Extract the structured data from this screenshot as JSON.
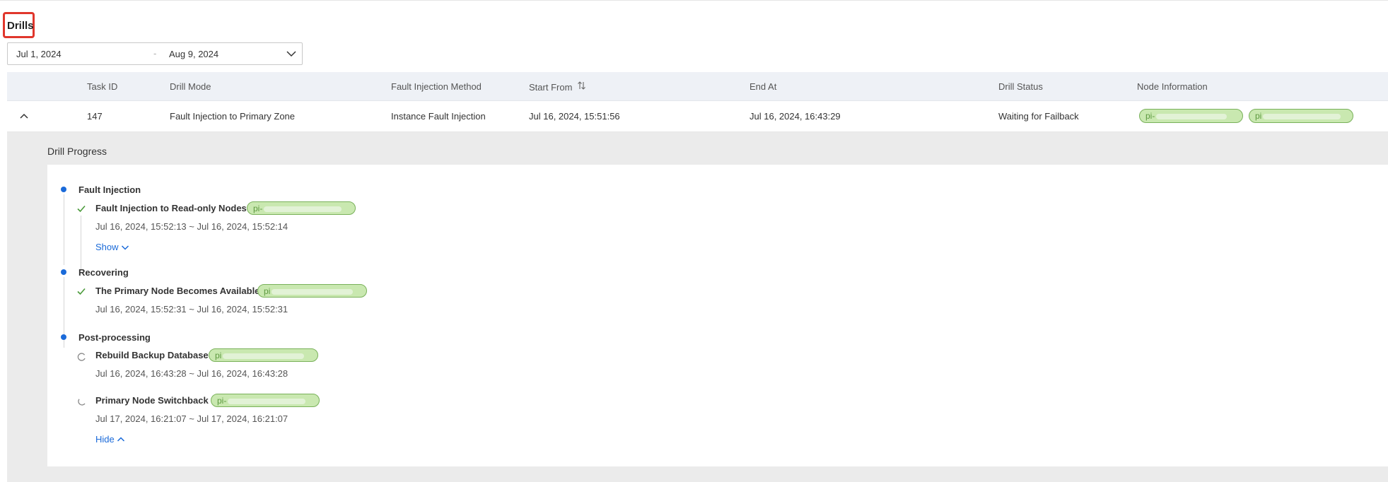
{
  "page": {
    "title": "Drills"
  },
  "date_range": {
    "start": "Jul 1, 2024",
    "separator": "-",
    "end": "Aug 9, 2024"
  },
  "table": {
    "columns": [
      "Task ID",
      "Drill Mode",
      "Fault Injection Method",
      "Start From",
      "End At",
      "Drill Status",
      "Node Information"
    ],
    "rows": [
      {
        "task_id": "147",
        "drill_mode": "Fault Injection to Primary Zone",
        "fault_method": "Instance Fault Injection",
        "start_from": "Jul 16, 2024, 15:51:56",
        "end_at": "Jul 16, 2024, 16:43:29",
        "status": "Waiting for Failback",
        "nodes": [
          "pi-",
          "pi"
        ]
      }
    ]
  },
  "progress": {
    "title": "Drill Progress",
    "stages": [
      {
        "label": "Fault Injection",
        "steps": [
          {
            "label": "Fault Injection to Read-only Nodes",
            "tag": "pi-",
            "time": "Jul 16, 2024, 15:52:13 ~ Jul 16, 2024, 15:52:14",
            "state": "done"
          }
        ],
        "toggle": "Show"
      },
      {
        "label": "Recovering",
        "steps": [
          {
            "label": "The Primary Node Becomes Available",
            "tag": "pi",
            "time": "Jul 16, 2024, 15:52:31 ~ Jul 16, 2024, 15:52:31",
            "state": "done"
          }
        ]
      },
      {
        "label": "Post-processing",
        "steps": [
          {
            "label": "Rebuild Backup Database",
            "tag": "pi",
            "time": "Jul 16, 2024, 16:43:28 ~ Jul 16, 2024, 16:43:28",
            "state": "running"
          },
          {
            "label": "Primary Node Switchback",
            "tag": "pi-",
            "time": "Jul 17, 2024, 16:21:07 ~ Jul 17, 2024, 16:21:07",
            "state": "running"
          }
        ],
        "toggle": "Hide"
      }
    ]
  },
  "colors": {
    "accent": "#1a6ad9",
    "success": "#4a9a3a",
    "tag_bg": "#c9e8b0",
    "highlight": "#e0362c"
  }
}
